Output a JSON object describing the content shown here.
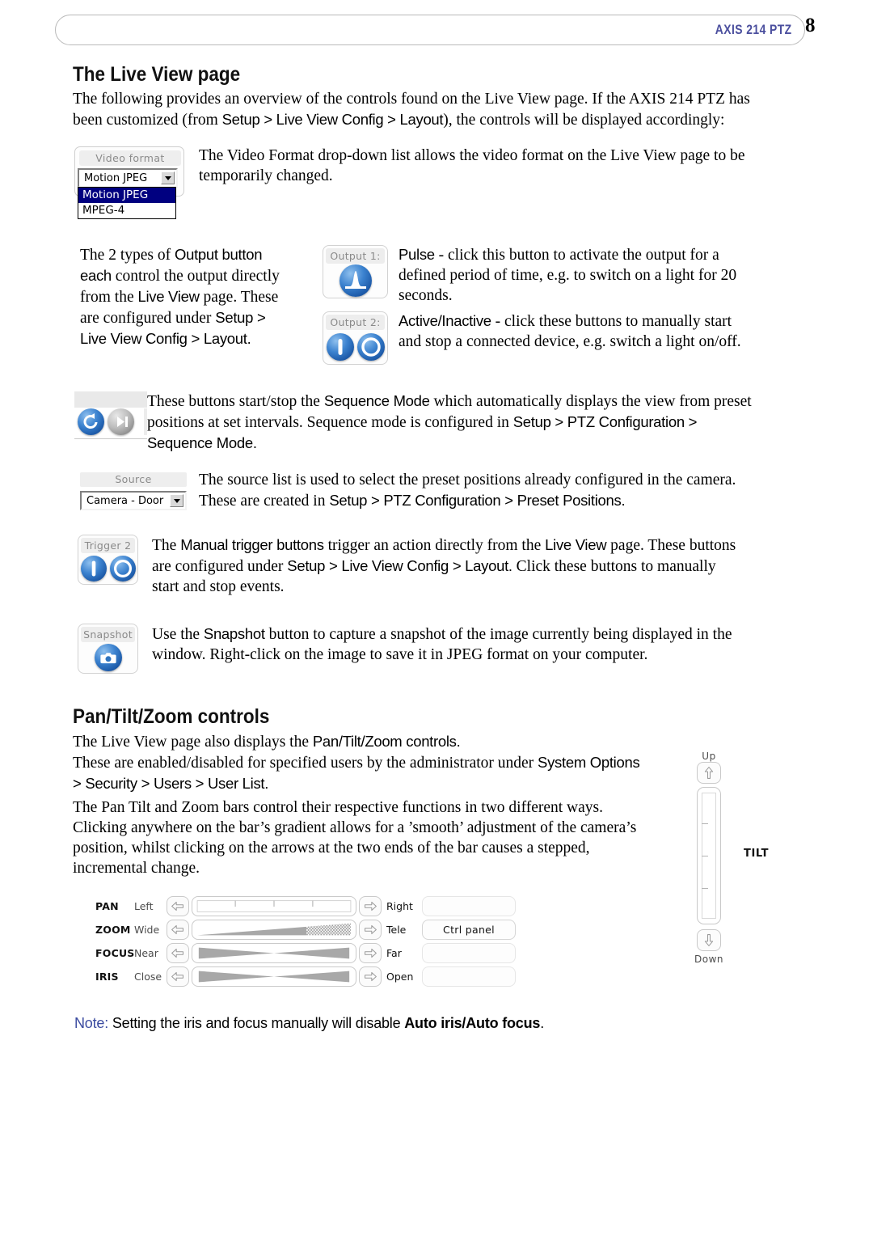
{
  "header": {
    "title": "AXIS 214 PTZ",
    "page_number": "8"
  },
  "sections": {
    "live_view": {
      "heading": "The Live View page",
      "intro_line1": "The following provides an overview of the controls found on the Live View page. If the AXIS 214 PTZ has",
      "intro_line2_a": "been customized (from ",
      "intro_line2_ui": "Setup > Live View Config > Layout",
      "intro_line2_b": "), the controls will be displayed accordingly:"
    },
    "ptz": {
      "heading": "Pan/Tilt/Zoom controls",
      "p1_a": "The Live View page also displays the ",
      "p1_ui": "Pan/Tilt/Zoom controls.",
      "p2_a": "These are enabled/disabled for specified users by the administrator under ",
      "p2_ui1": "System Options",
      "p2_ui2": "> Security > Users > User List.",
      "p3_line1": "The Pan Tilt and Zoom bars control their respective functions in two different ways.",
      "p3_line2": "Clicking anywhere on the bar’s gradient allows for a ’smooth’ adjustment of the camera’s",
      "p3_line3": "position, whilst clicking on the arrows at the two ends of the bar causes a stepped,",
      "p3_line4": "incremental change."
    }
  },
  "video_format": {
    "panel_label": "Video format",
    "selected": "Motion JPEG",
    "options": [
      "Motion JPEG",
      "MPEG-4"
    ],
    "description_line1": "The Video Format drop-down list allows the video format on the Live View page to be",
    "description_line2": "temporarily changed."
  },
  "output": {
    "left_text": {
      "l1_a": "The 2 types of ",
      "l1_ui": "Output button",
      "l2_ui": "each",
      "l2_b": " control the output directly",
      "l3_a": "from the ",
      "l3_ui": "Live View",
      "l3_b": " page. These",
      "l4_a": "are configured under ",
      "l4_ui": "Setup >",
      "l5_ui": "Live View Config > Layout."
    },
    "output1": {
      "label": "Output 1:",
      "icon": "pulse-icon"
    },
    "output2": {
      "label": "Output 2:",
      "icons": [
        "active-icon",
        "inactive-icon"
      ]
    },
    "pulse_line1_bold": "Pulse",
    "pulse_line1_rest": " - click this button to activate the output for a",
    "pulse_line2": "defined period of time, e.g. to switch on a light for 20",
    "pulse_line3": "seconds.",
    "active_line1_bold": "Active/Inactive",
    "active_line1_rest": " - click these buttons to manually start",
    "active_line2": "and stop a connected device, e.g. switch a light on/off."
  },
  "sequence": {
    "icons": [
      "sequence-back-icon",
      "sequence-forward-icon"
    ],
    "l1_a": "These buttons start/stop the ",
    "l1_ui": "Sequence Mode",
    "l1_b": " which automatically displays the view from preset",
    "l2_a": "positions at set intervals. Sequence mode is configured in ",
    "l2_ui": "Setup > PTZ Configuration >",
    "l3_ui": "Sequence Mode."
  },
  "source": {
    "panel_label": "Source",
    "selected": "Camera - Door",
    "line1": "The source list is used to select the preset positions already configured in the camera.",
    "line2_a": "These are created in ",
    "line2_ui": "Setup > PTZ Configuration > Preset Positions."
  },
  "trigger": {
    "label": "Trigger 2",
    "icons": [
      "trigger-active-icon",
      "trigger-inactive-icon"
    ],
    "l1_a": "The ",
    "l1_ui": "Manual trigger buttons",
    "l1_b": " trigger an action directly from the ",
    "l1_ui2": "Live View",
    "l1_c": " page. These buttons",
    "l2_a": "are configured under ",
    "l2_ui": "Setup > Live View Config > Layout.",
    "l2_b": " Click these buttons to manually",
    "l3": "start and stop events."
  },
  "snapshot": {
    "label": "Snapshot",
    "icon": "camera-icon",
    "l1_a": "Use the ",
    "l1_ui": "Snapshot",
    "l1_b": " button to capture a snapshot of the image currently being displayed in the",
    "l2": "window. Right-click on the image to save it in JPEG format on your computer."
  },
  "tilt_control": {
    "up_label": "Up",
    "down_label": "Down",
    "axis_label": "TILT"
  },
  "ptz_controls": {
    "rows": [
      {
        "name": "PAN",
        "low": "Left",
        "high": "Right",
        "box": "",
        "bar": "ticks"
      },
      {
        "name": "ZOOM",
        "low": "Wide",
        "high": "Tele",
        "box": "Ctrl panel",
        "bar": "zoom"
      },
      {
        "name": "FOCUS",
        "low": "Near",
        "high": "Far",
        "box": "",
        "bar": "bowtie"
      },
      {
        "name": "IRIS",
        "low": "Close",
        "high": "Open",
        "box": "",
        "bar": "bowtie"
      }
    ]
  },
  "note": {
    "label": "Note:",
    "text_a": " Setting the iris and focus manually will disable ",
    "text_bold": "Auto iris/Auto focus",
    "text_b": "."
  },
  "colors": {
    "header_blue": "#4b4f9e",
    "note_blue": "#3b4ba0",
    "select_highlight": "#000080",
    "button_blue": "#1d5aa8",
    "button_grey": "#8f8f8f"
  }
}
